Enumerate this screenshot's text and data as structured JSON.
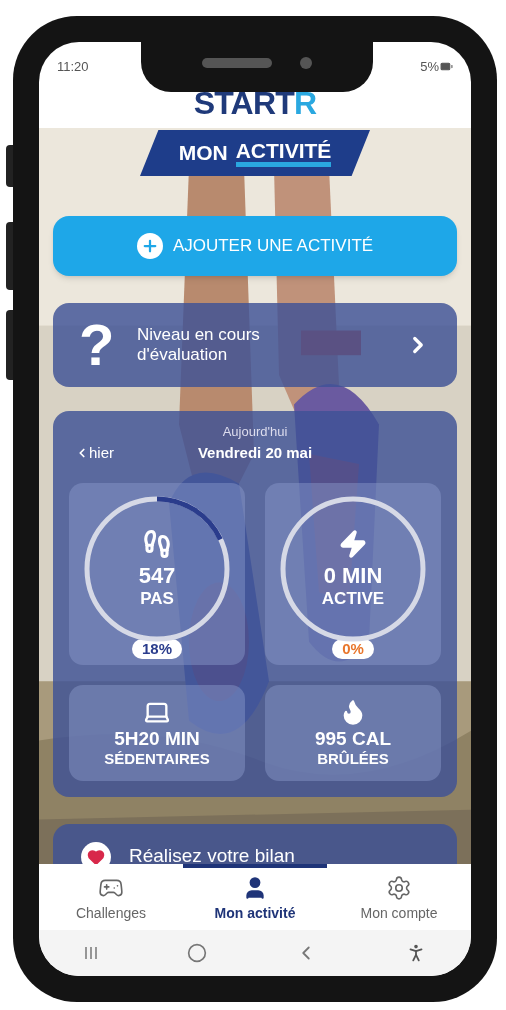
{
  "status_bar": {
    "time": "11:20",
    "battery": "5%"
  },
  "logo": {
    "text": "START",
    "accent": "R"
  },
  "banner": {
    "first": "MON",
    "second": "ACTIVITÉ"
  },
  "add_button": {
    "label": "AJOUTER UNE ACTIVITÉ"
  },
  "level_card": {
    "icon": "?",
    "text": "Niveau en cours d'évaluation"
  },
  "day": {
    "caption": "Aujourd'hui",
    "date": "Vendredi 20 mai",
    "previous": "hier"
  },
  "goals": [
    {
      "kind": "steps",
      "value": "547",
      "unit": "PAS",
      "level": 0.18,
      "percent": "18%",
      "color": "#2a3c8c"
    },
    {
      "kind": "active",
      "value": "0 MIN",
      "unit": "ACTIVE",
      "level": 0,
      "percent": "0%",
      "color": "#e8762c"
    }
  ],
  "totals": [
    {
      "kind": "sedentary",
      "value": "5H20 MIN",
      "unit": "SÉDENTAIRES"
    },
    {
      "kind": "calories",
      "value": "995 CAL",
      "unit": "BRÛLÉES"
    }
  ],
  "next_card": {
    "text": "Réalisez votre bilan"
  },
  "tabs": [
    {
      "kind": "challenges",
      "label": "Challenges",
      "selected": false
    },
    {
      "kind": "activity",
      "label": "Mon activité",
      "selected": true
    },
    {
      "kind": "account",
      "label": "Mon compte",
      "selected": false
    }
  ]
}
